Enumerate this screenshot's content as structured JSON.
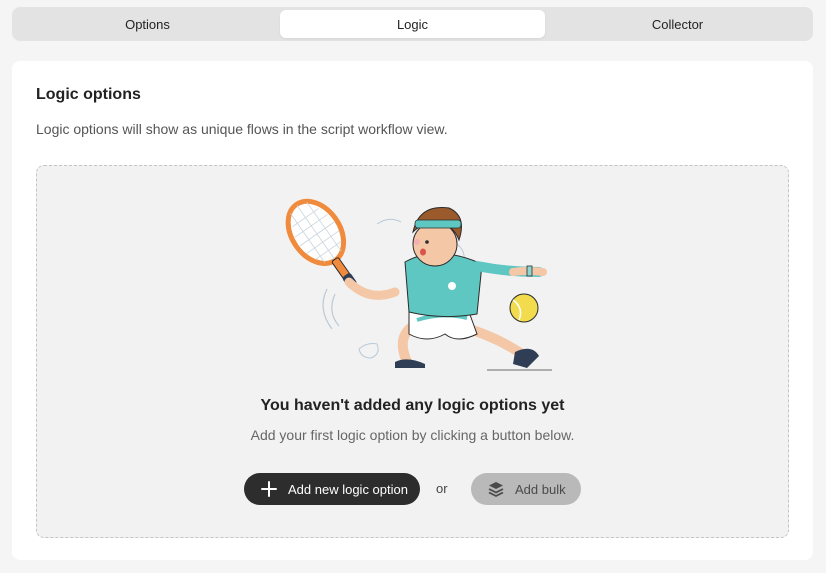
{
  "tabs": [
    {
      "label": "Options",
      "active": false
    },
    {
      "label": "Logic",
      "active": true
    },
    {
      "label": "Collector",
      "active": false
    }
  ],
  "section": {
    "title": "Logic options",
    "description": "Logic options will show as unique flows in the script workflow view."
  },
  "empty_state": {
    "illustration": "tennis-player-illustration",
    "title": "You haven't added any logic options yet",
    "subtitle": "Add your first logic option by clicking a button below.",
    "primary_button": {
      "label": "Add new logic option",
      "icon": "plus-icon"
    },
    "separator": "or",
    "secondary_button": {
      "label": "Add bulk",
      "icon": "layers-icon"
    }
  },
  "colors": {
    "background": "#f5f5f5",
    "tab_bar": "#e3e3e3",
    "primary_button": "#2d2d2d",
    "secondary_button": "#b9b9b9",
    "empty_box": "#f2f2f2",
    "accent_teal": "#5fc7c2",
    "accent_orange": "#f08a3c",
    "ball_yellow": "#f2dc4e"
  }
}
